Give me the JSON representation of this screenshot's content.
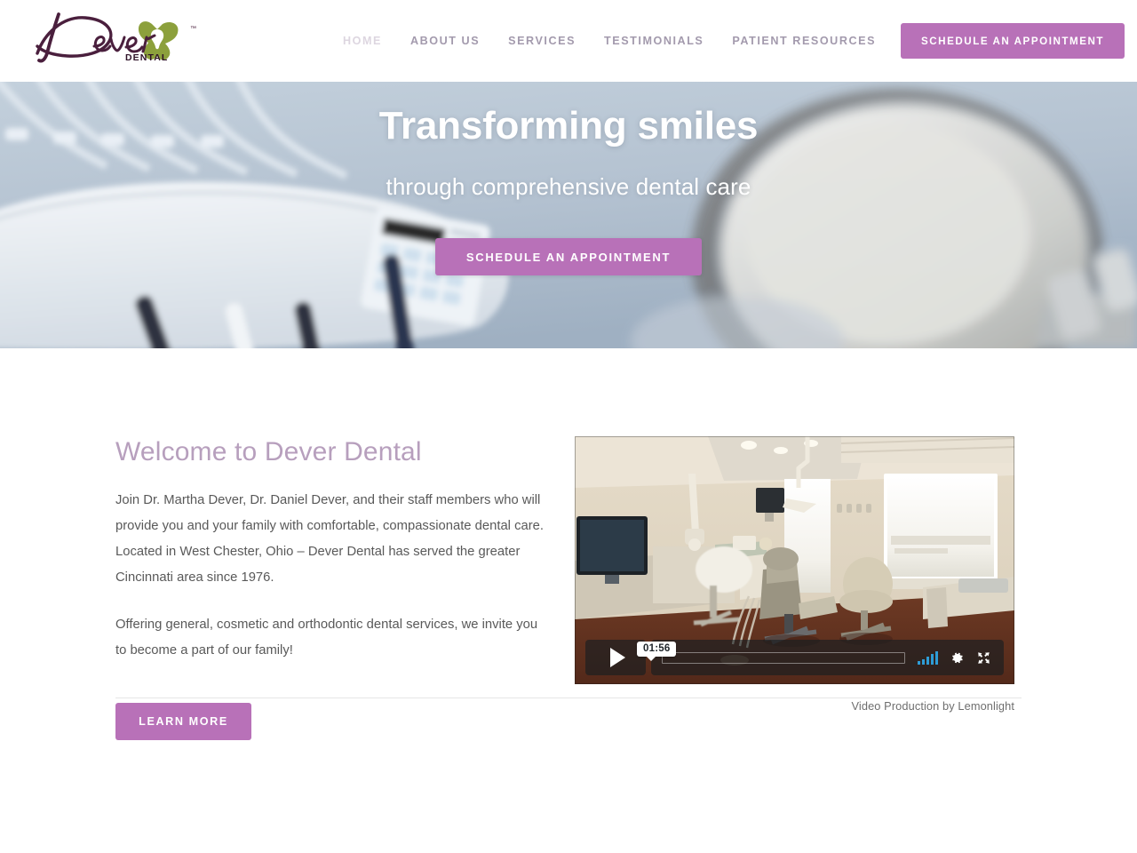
{
  "site": {
    "brand_name": "Dever",
    "brand_sub": "DENTAL",
    "trademark": "™",
    "accent_color": "#b871b8",
    "logo_script_color": "#4a1f3d",
    "logo_mark_color": "#8ca03c"
  },
  "header": {
    "nav": [
      {
        "label": "HOME",
        "active": true
      },
      {
        "label": "ABOUT US",
        "active": false
      },
      {
        "label": "SERVICES",
        "active": false
      },
      {
        "label": "TESTIMONIALS",
        "active": false
      },
      {
        "label": "PATIENT RESOURCES",
        "active": false
      }
    ],
    "cta_label": "SCHEDULE AN APPOINTMENT"
  },
  "hero": {
    "title": "Transforming smiles",
    "subtitle": "through comprehensive dental care",
    "cta_label": "SCHEDULE AN APPOINTMENT",
    "background_description": "dental instrument tray with handpieces on left, blurred dental light and mirror on right"
  },
  "welcome": {
    "heading": "Welcome to Dever Dental",
    "paragraph_1": "Join Dr. Martha Dever, Dr. Daniel Dever, and their staff members who will provide you and your family with comfortable, compassionate dental care. Located in West Chester, Ohio – Dever Dental has served the greater Cincinnati area since 1976.",
    "paragraph_2": "Offering general, cosmetic and orthodontic dental services, we invite you to become a part of our family!",
    "button_label": "LEARN MORE"
  },
  "video": {
    "time_label": "01:56",
    "credit": "Video Production by Lemonlight",
    "poster_description": "dental operatory room with patient chair, monitor, stool and bright window",
    "volume_color": "#2e9cd6",
    "icons": {
      "play": "play-icon",
      "volume": "volume-icon",
      "settings": "gear-icon",
      "fullscreen": "fullscreen-icon"
    }
  }
}
